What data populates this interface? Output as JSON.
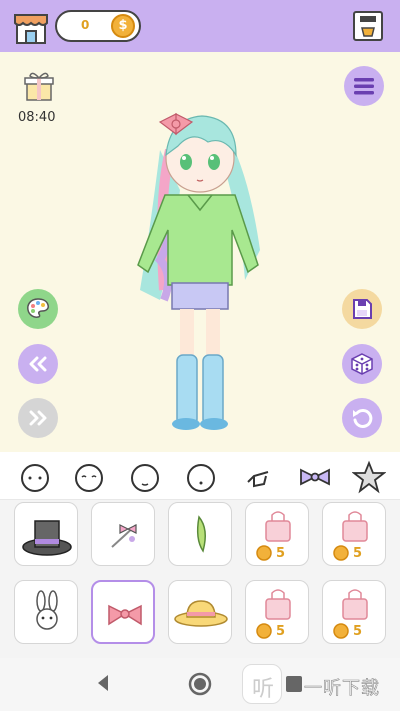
{
  "topbar": {
    "coins": "0",
    "coin_symbol": "$"
  },
  "stage": {
    "timer": "08:40"
  },
  "grid": {
    "price": "5"
  },
  "watermark": {
    "logo_char": "听",
    "text": "一听下载"
  },
  "colors": {
    "accent": "#c9b0f0",
    "stage_bg": "#fbf8e4",
    "coin": "#f2b13a"
  }
}
